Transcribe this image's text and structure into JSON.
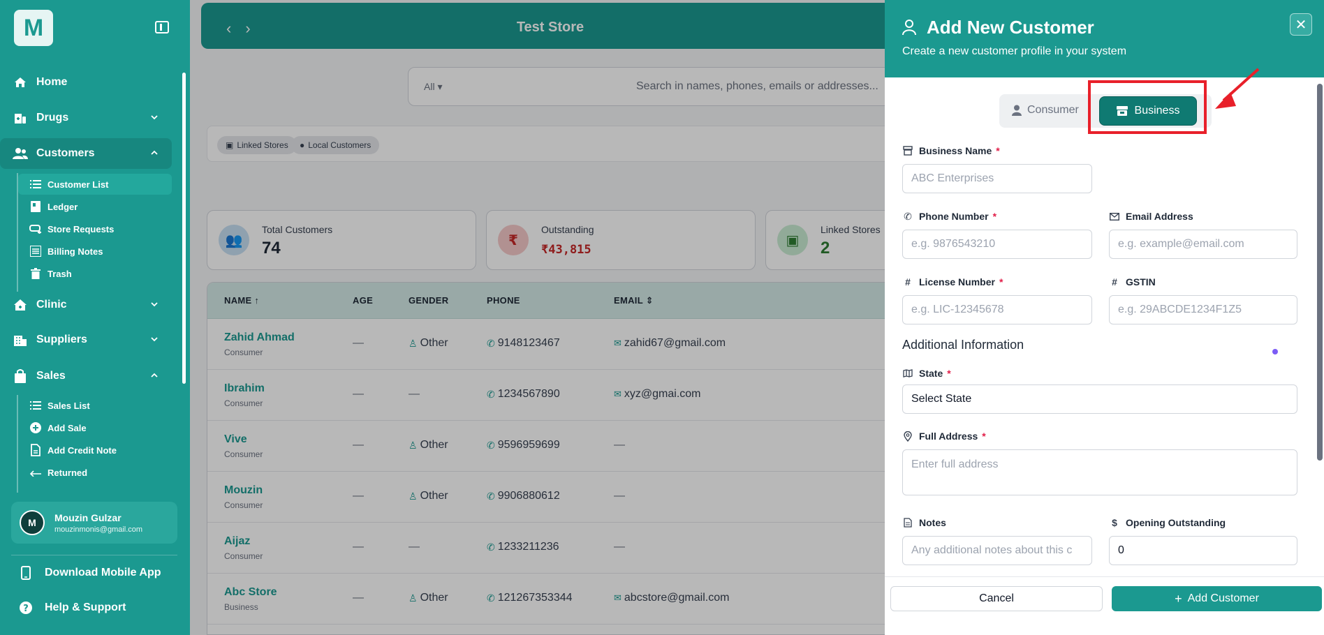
{
  "sidebar": {
    "logo": "M",
    "items": [
      {
        "label": "Home",
        "icon": "home-icon"
      },
      {
        "label": "Drugs",
        "icon": "pharmacy-icon"
      },
      {
        "label": "Customers",
        "icon": "users-icon"
      },
      {
        "label": "Clinic",
        "icon": "clinic-icon"
      },
      {
        "label": "Suppliers",
        "icon": "building-icon"
      },
      {
        "label": "Sales",
        "icon": "bag-icon"
      }
    ],
    "customer_sub": [
      {
        "label": "Customer List",
        "icon": "list-icon"
      },
      {
        "label": "Ledger",
        "icon": "book-icon"
      },
      {
        "label": "Store Requests",
        "icon": "link-icon"
      },
      {
        "label": "Billing Notes",
        "icon": "notes-icon"
      },
      {
        "label": "Trash",
        "icon": "trash-icon"
      }
    ],
    "sales_sub": [
      {
        "label": "Sales List",
        "icon": "list-icon"
      },
      {
        "label": "Add Sale",
        "icon": "plus-circle-icon"
      },
      {
        "label": "Add Credit Note",
        "icon": "file-icon"
      },
      {
        "label": "Returned",
        "icon": "return-icon"
      }
    ],
    "user": {
      "initial": "M",
      "name": "Mouzin Gulzar",
      "email": "mouzinmonis@gmail.com"
    },
    "footer": [
      {
        "label": "Download Mobile App",
        "icon": "phone-icon"
      },
      {
        "label": "Help & Support",
        "icon": "help-icon"
      }
    ]
  },
  "topbar": {
    "title": "Test Store"
  },
  "search": {
    "filter": "All",
    "placeholder": "Search in names, phones, emails or addresses..."
  },
  "chips": [
    "Linked Stores",
    "Local Customers"
  ],
  "stats": [
    {
      "label": "Total Customers",
      "value": "74"
    },
    {
      "label": "Outstanding",
      "value": "₹43,815"
    },
    {
      "label": "Linked Stores",
      "value": "2"
    }
  ],
  "table": {
    "headers": [
      "NAME",
      "AGE",
      "GENDER",
      "PHONE",
      "EMAIL"
    ],
    "rows": [
      {
        "name": "Zahid Ahmad",
        "type": "Consumer",
        "age": "—",
        "gender": "Other",
        "phone": "9148123467",
        "email": "zahid67@gmail.com"
      },
      {
        "name": "Ibrahim",
        "type": "Consumer",
        "age": "—",
        "gender": "—",
        "phone": "1234567890",
        "email": "xyz@gmai.com"
      },
      {
        "name": "Vive",
        "type": "Consumer",
        "age": "—",
        "gender": "Other",
        "phone": "9596959699",
        "email": "—"
      },
      {
        "name": "Mouzin",
        "type": "Consumer",
        "age": "—",
        "gender": "Other",
        "phone": "9906880612",
        "email": "—"
      },
      {
        "name": "Aijaz",
        "type": "Consumer",
        "age": "—",
        "gender": "—",
        "phone": "1233211236",
        "email": "—"
      },
      {
        "name": "Abc Store",
        "type": "Business",
        "age": "—",
        "gender": "Other",
        "phone": "121267353344",
        "email": "abcstore@gmail.com"
      }
    ]
  },
  "drawer": {
    "title": "Add New Customer",
    "subtitle": "Create a new customer profile in your system",
    "toggle": {
      "consumer": "Consumer",
      "business": "Business"
    },
    "fields": {
      "business_name": {
        "label": "Business Name",
        "placeholder": "ABC Enterprises"
      },
      "phone": {
        "label": "Phone Number",
        "placeholder": "e.g. 9876543210"
      },
      "email": {
        "label": "Email Address",
        "placeholder": "e.g. example@email.com"
      },
      "license": {
        "label": "License Number",
        "placeholder": "e.g. LIC-12345678"
      },
      "gstin": {
        "label": "GSTIN",
        "placeholder": "e.g. 29ABCDE1234F1Z5"
      },
      "state": {
        "label": "State",
        "value": "Select State"
      },
      "address": {
        "label": "Full Address",
        "placeholder": "Enter full address"
      },
      "notes": {
        "label": "Notes",
        "placeholder": "Any additional notes about this c"
      },
      "opening": {
        "label": "Opening Outstanding",
        "value": "0"
      }
    },
    "section": "Additional Information",
    "required_mark": "*",
    "cancel": "Cancel",
    "submit": "Add Customer"
  },
  "colors": {
    "primary": "#1b9990",
    "highlight": "#e8202a"
  }
}
